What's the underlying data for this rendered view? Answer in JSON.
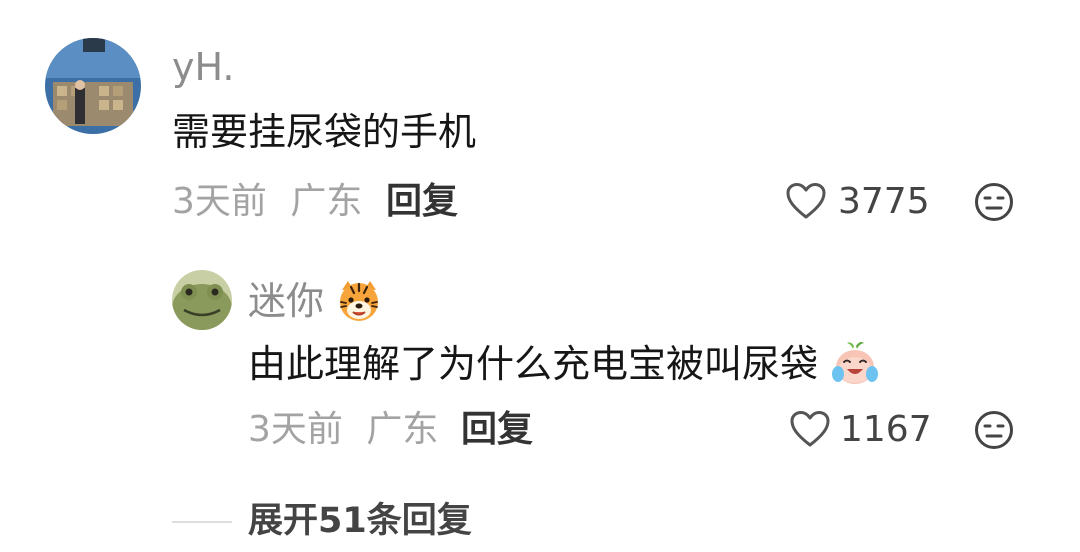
{
  "comment": {
    "username": "yH.",
    "content": "需要挂尿袋的手机",
    "time": "3天前",
    "location": "广东",
    "reply_label": "回复",
    "like_count": "3775",
    "like_icon": "heart-outline-icon",
    "react_icon": "meh-face-icon"
  },
  "reply": {
    "username": "迷你",
    "username_emoji": "tiger-face-emoji",
    "content": "由此理解了为什么充电宝被叫尿袋",
    "content_emoji": "laughing-crying-peach-emoji",
    "time": "3天前",
    "location": "广东",
    "reply_label": "回复",
    "like_count": "1167",
    "like_icon": "heart-outline-icon",
    "react_icon": "meh-face-icon"
  },
  "expand": {
    "label": "展开51条回复"
  }
}
